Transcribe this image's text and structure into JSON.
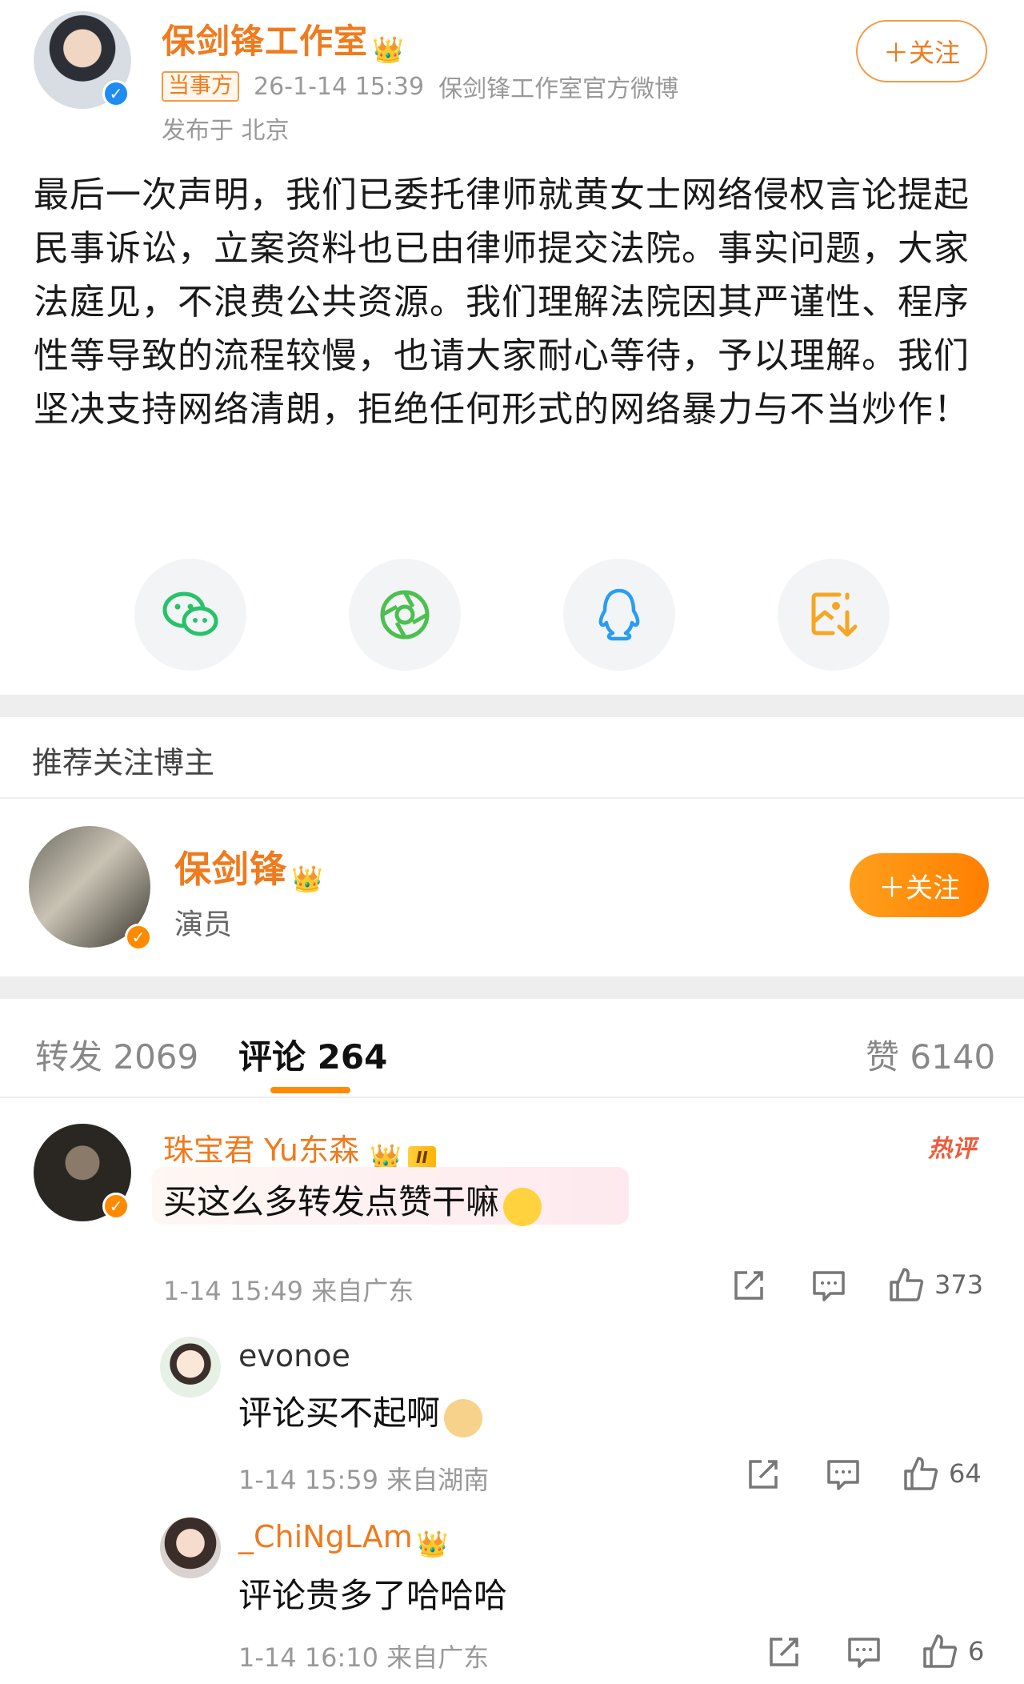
{
  "post": {
    "author": "保剑锋工作室",
    "tag": "当事方",
    "timestamp": "26-1-14 15:39",
    "source": "保剑锋工作室官方微博",
    "location": "发布于 北京",
    "follow_label": "＋关注",
    "content": "最后一次声明，我们已委托律师就黄女士网络侵权言论提起民事诉讼，立案资料也已由律师提交法院。事实问题，大家法庭见，不浪费公共资源。我们理解法院因其严谨性、程序性等导致的流程较慢，也请大家耐心等待，予以理解。我们坚决支持网络清朗，拒绝任何形式的网络暴力与不当炒作！"
  },
  "share": {
    "items": [
      {
        "icon": "wechat-icon",
        "color": "#27c26b"
      },
      {
        "icon": "moments-icon",
        "color": "#4cbf4f"
      },
      {
        "icon": "qq-icon",
        "color": "#2a9cf3"
      },
      {
        "icon": "save-image-icon",
        "color": "#f5a623"
      }
    ]
  },
  "recommend": {
    "title": "推荐关注博主",
    "name": "保剑锋",
    "desc": "演员",
    "follow_label": "＋关注"
  },
  "tabs": {
    "repost": "转发 2069",
    "comment": "评论 264",
    "like": "赞 6140"
  },
  "comments": [
    {
      "name": "珠宝君 Yu东森",
      "level": "II",
      "hot": "热评",
      "text": "买这么多转发点赞干嘛",
      "time": "1-14 15:49 来自广东",
      "likes": "373",
      "replies": [
        {
          "name": "evonoe",
          "text": "评论买不起啊",
          "time": "1-14 15:59 来自湖南",
          "likes": "64"
        },
        {
          "name": "_ChiNgLAm",
          "text": "评论贵多了哈哈哈",
          "time": "1-14 16:10 来自广东",
          "likes": "6"
        }
      ]
    }
  ],
  "colors": {
    "accent": "#ef7b1e",
    "verified_blue": "#1f8cf2",
    "hot_red": "#f05b3b"
  }
}
